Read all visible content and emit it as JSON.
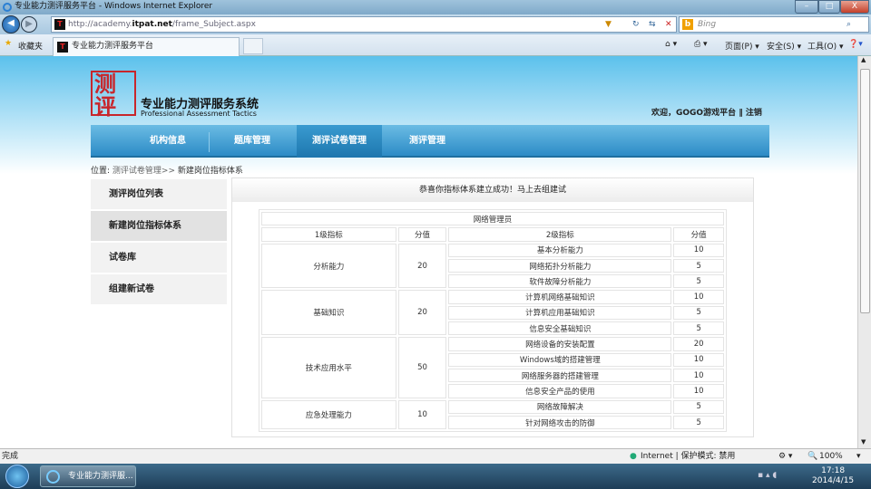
{
  "window": {
    "title": "专业能力测评服务平台 - Windows Internet Explorer"
  },
  "address": {
    "url_prefix": "http://academy.",
    "url_domain": "itpat.net",
    "url_path": "/frame_Subject.aspx",
    "search_placeholder": "Bing"
  },
  "favbar": {
    "favorites": "收藏夹",
    "tab_title": "专业能力测评服务平台",
    "page_menu": "页面(P) ▾",
    "safety_menu": "安全(S) ▾",
    "tools_menu": "工具(O) ▾"
  },
  "header": {
    "logo_text": "测评",
    "system_name": "专业能力测评服务系统",
    "system_name_en": "Professional Assessment Tactics",
    "welcome": "欢迎，GOGO游戏平台 ‖ 注销"
  },
  "nav": {
    "items": [
      {
        "label": "机构信息"
      },
      {
        "label": "题库管理"
      },
      {
        "label": "测评试卷管理",
        "active": true
      },
      {
        "label": "测评管理"
      }
    ]
  },
  "breadcrumb": {
    "prefix": "位置:",
    "link": "测评试卷管理>>",
    "current": "新建岗位指标体系"
  },
  "sidebar": {
    "items": [
      {
        "label": "测评岗位列表"
      },
      {
        "label": "新建岗位指标体系",
        "active": true
      },
      {
        "label": "试卷库"
      },
      {
        "label": "组建新试卷"
      }
    ]
  },
  "main": {
    "message": "恭喜你指标体系建立成功！马上去组建试",
    "table": {
      "title": "网络管理员",
      "headers": [
        "1级指标",
        "分值",
        "2级指标",
        "分值"
      ],
      "groups": [
        {
          "name": "分析能力",
          "score": "20",
          "items": [
            {
              "name": "基本分析能力",
              "score": "10"
            },
            {
              "name": "网络拓扑分析能力",
              "score": "5"
            },
            {
              "name": "软件故障分析能力",
              "score": "5"
            }
          ]
        },
        {
          "name": "基础知识",
          "score": "20",
          "items": [
            {
              "name": "计算机网络基础知识",
              "score": "10"
            },
            {
              "name": "计算机应用基础知识",
              "score": "5"
            },
            {
              "name": "信息安全基础知识",
              "score": "5"
            }
          ]
        },
        {
          "name": "技术应用水平",
          "score": "50",
          "items": [
            {
              "name": "网络设备的安装配置",
              "score": "20"
            },
            {
              "name": "Windows域的搭建管理",
              "score": "10"
            },
            {
              "name": "网络服务器的搭建管理",
              "score": "10"
            },
            {
              "name": "信息安全产品的使用",
              "score": "10"
            }
          ]
        },
        {
          "name": "应急处理能力",
          "score": "10",
          "items": [
            {
              "name": "网络故障解决",
              "score": "5"
            },
            {
              "name": "针对网络攻击的防御",
              "score": "5"
            }
          ]
        }
      ]
    }
  },
  "status": {
    "text": "完成",
    "zone": "Internet | 保护模式: 禁用",
    "zoom": "100%"
  },
  "taskbar": {
    "task": "专业能力测评服...",
    "time": "17:18",
    "date": "2014/4/15"
  }
}
